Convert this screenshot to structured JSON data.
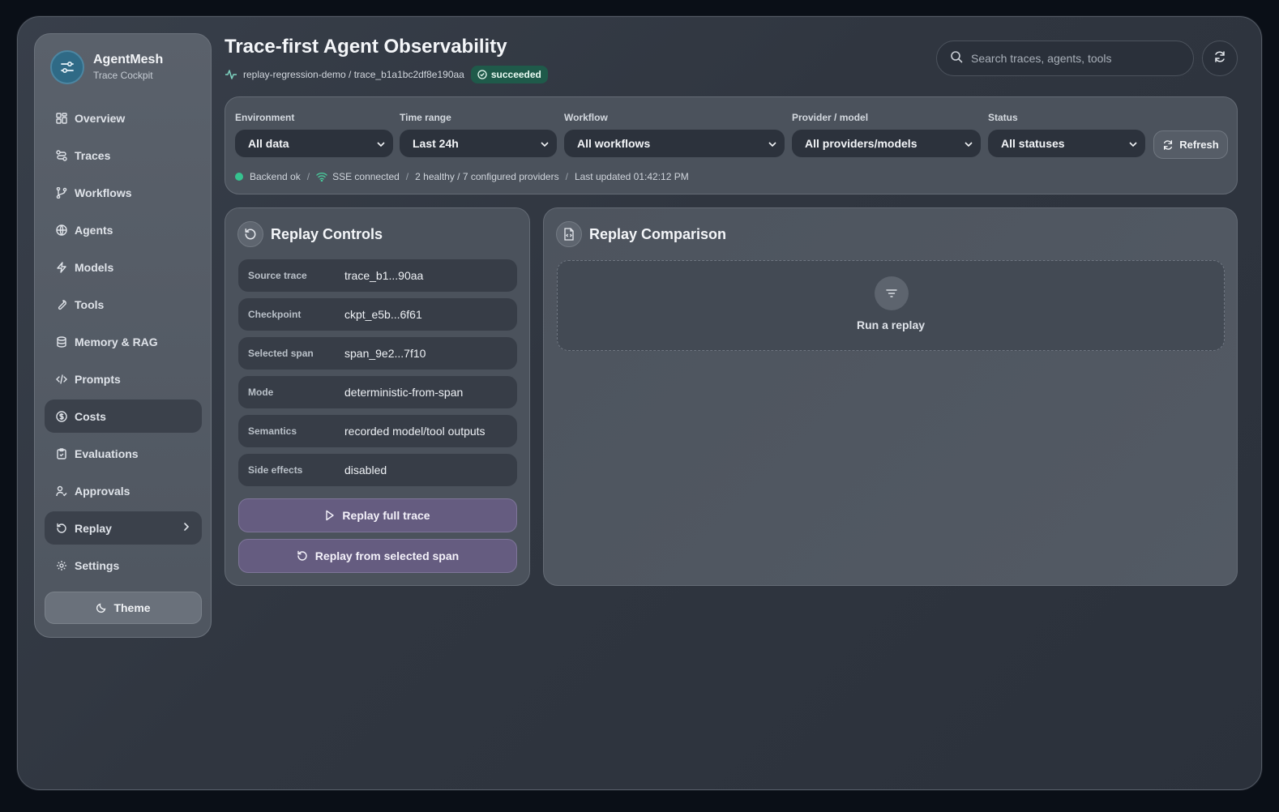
{
  "app": {
    "name": "AgentMesh",
    "subtitle": "Trace Cockpit"
  },
  "sidebar": {
    "items": [
      {
        "label": "Overview",
        "icon": "grid-icon"
      },
      {
        "label": "Traces",
        "icon": "route-icon"
      },
      {
        "label": "Workflows",
        "icon": "branch-icon"
      },
      {
        "label": "Agents",
        "icon": "globe-icon"
      },
      {
        "label": "Models",
        "icon": "bolt-icon"
      },
      {
        "label": "Tools",
        "icon": "wrench-icon"
      },
      {
        "label": "Memory & RAG",
        "icon": "database-icon"
      },
      {
        "label": "Prompts",
        "icon": "code-icon"
      },
      {
        "label": "Costs",
        "icon": "dollar-icon"
      },
      {
        "label": "Evaluations",
        "icon": "clipboard-icon"
      },
      {
        "label": "Approvals",
        "icon": "user-check-icon"
      },
      {
        "label": "Replay",
        "icon": "replay-icon"
      },
      {
        "label": "Settings",
        "icon": "gear-icon"
      }
    ],
    "active": [
      "Costs",
      "Replay"
    ],
    "theme_label": "Theme"
  },
  "header": {
    "title": "Trace-first Agent Observability",
    "breadcrumb": "replay-regression-demo / trace_b1a1bc2df8e190aa",
    "status": "succeeded",
    "search_placeholder": "Search traces, agents, tools"
  },
  "filters": {
    "environment": {
      "label": "Environment",
      "value": "All data"
    },
    "time_range": {
      "label": "Time range",
      "value": "Last 24h"
    },
    "workflow": {
      "label": "Workflow",
      "value": "All workflows"
    },
    "provider": {
      "label": "Provider / model",
      "value": "All providers/models"
    },
    "status": {
      "label": "Status",
      "value": "All statuses"
    },
    "refresh_label": "Refresh"
  },
  "statusline": {
    "backend": "Backend ok",
    "sse": "SSE connected",
    "providers": "2 healthy / 7 configured providers",
    "updated": "Last updated 01:42:12 PM",
    "separator": "/"
  },
  "replay_controls": {
    "title": "Replay Controls",
    "rows": [
      {
        "key": "Source trace",
        "value": "trace_b1...90aa"
      },
      {
        "key": "Checkpoint",
        "value": "ckpt_e5b...6f61"
      },
      {
        "key": "Selected span",
        "value": "span_9e2...7f10"
      },
      {
        "key": "Mode",
        "value": "deterministic-from-span"
      },
      {
        "key": "Semantics",
        "value": "recorded model/tool outputs"
      },
      {
        "key": "Side effects",
        "value": "disabled"
      }
    ],
    "replay_full_label": "Replay full trace",
    "replay_span_label": "Replay from selected span"
  },
  "replay_comparison": {
    "title": "Replay Comparison",
    "empty_text": "Run a replay"
  },
  "colors": {
    "accent": "#655c80",
    "success": "#36c28f",
    "badge": "#1f5a4a"
  }
}
